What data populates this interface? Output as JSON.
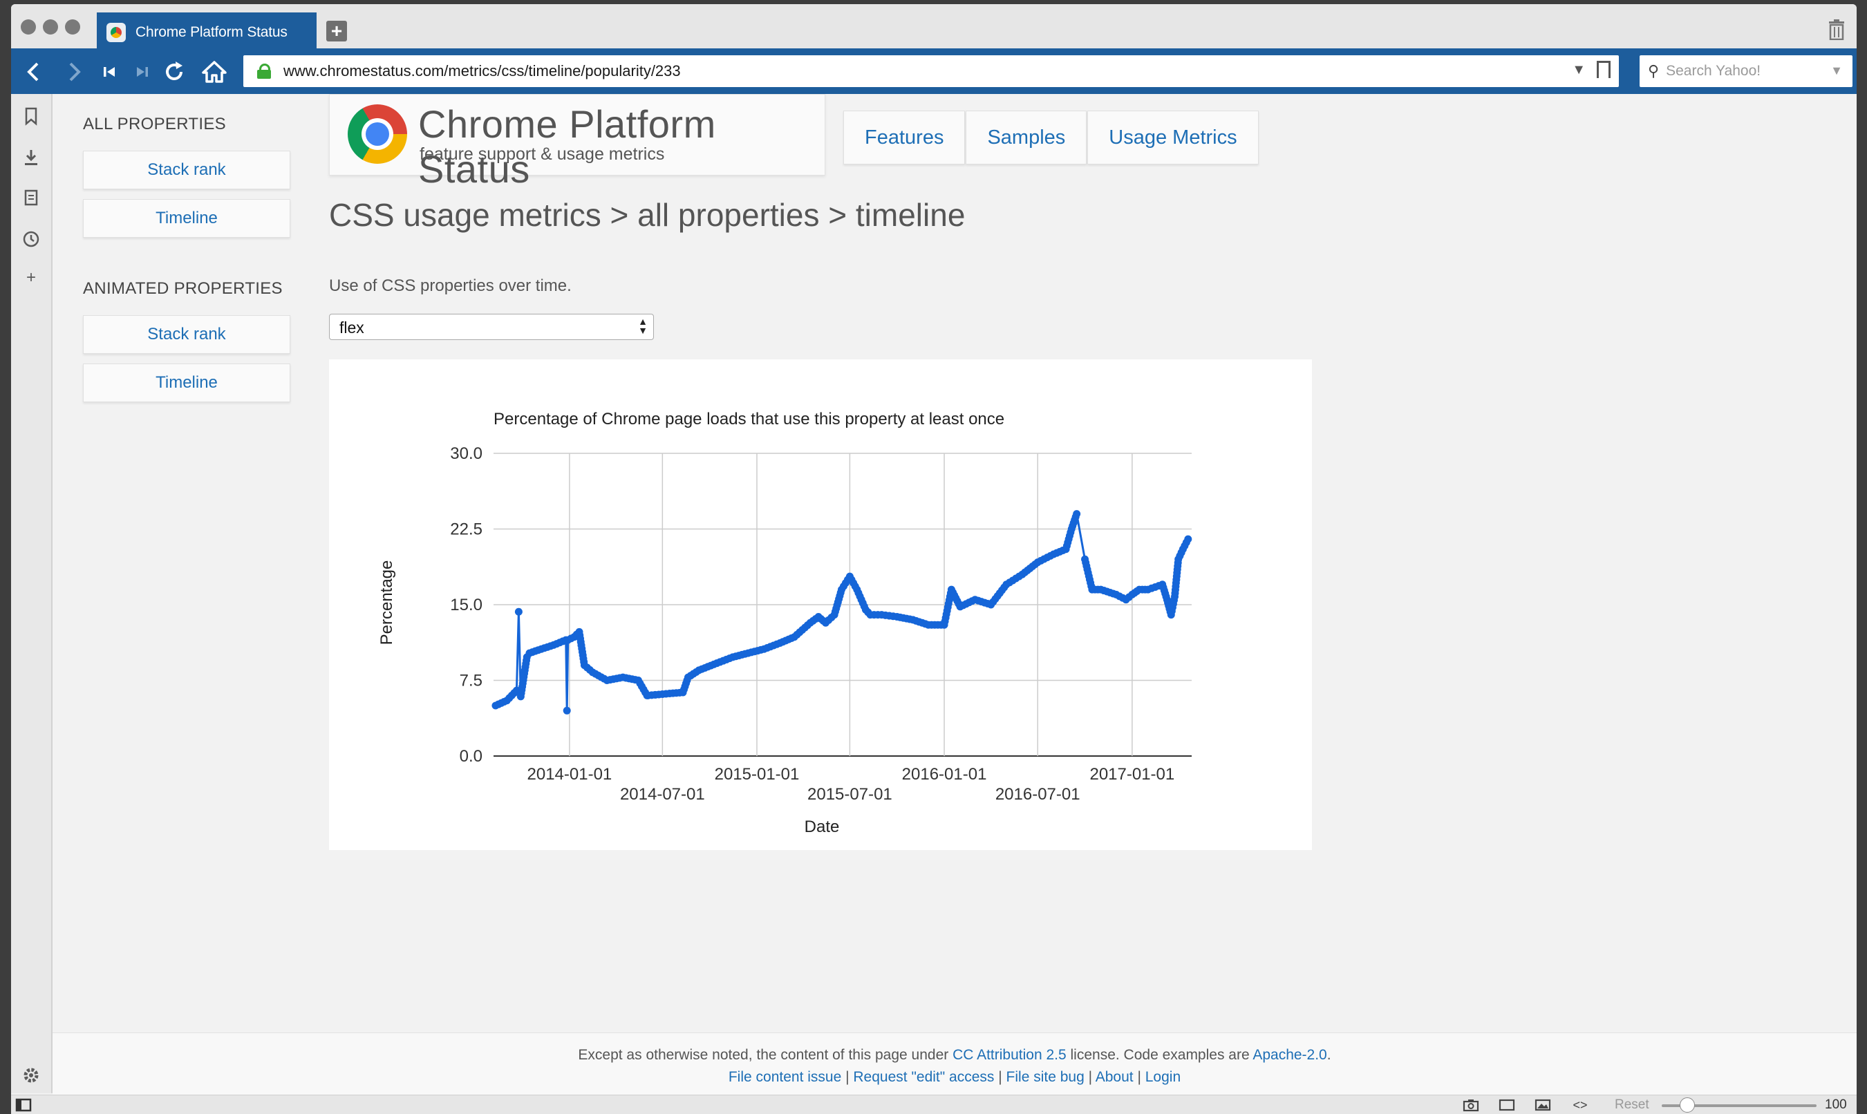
{
  "browser": {
    "tab_title": "Chrome Platform Status",
    "url": "www.chromestatus.com/metrics/css/timeline/popularity/233",
    "search_placeholder": "Search Yahoo!",
    "zoom": "100 %",
    "reset_label": "Reset"
  },
  "sidebar": {
    "all_heading": "ALL PROPERTIES",
    "all_items": [
      "Stack rank",
      "Timeline"
    ],
    "animated_heading": "ANIMATED PROPERTIES",
    "animated_items": [
      "Stack rank",
      "Timeline"
    ]
  },
  "brand": {
    "title": "Chrome Platform Status",
    "subtitle": "feature support & usage metrics"
  },
  "topnav": [
    "Features",
    "Samples",
    "Usage Metrics"
  ],
  "page": {
    "title": "CSS usage metrics > all properties > timeline",
    "intro": "Use of CSS properties over time.",
    "selected_property": "flex"
  },
  "chart_data": {
    "type": "line",
    "title": "Percentage of Chrome page loads that use this property at least once",
    "xlabel": "Date",
    "ylabel": "Percentage",
    "ylim": [
      0,
      30
    ],
    "yticks": [
      "0.0",
      "7.5",
      "15.0",
      "22.5",
      "30.0"
    ],
    "xticks_top": [
      "2014-01-01",
      "2015-01-01",
      "2016-01-01",
      "2017-01-01"
    ],
    "xticks_bottom": [
      "2014-07-01",
      "2015-07-01",
      "2016-07-01"
    ],
    "xlim": [
      "2013-08-06",
      "2017-04-27"
    ],
    "grid": true,
    "legend": "none",
    "color": "#1565d8",
    "series": [
      {
        "x": [
          "2013-08-10",
          "2013-09-01",
          "2013-09-20",
          "2013-09-24",
          "2013-09-28",
          "2013-10-10",
          "2013-10-15",
          "2013-11-01",
          "2013-12-01",
          "2013-12-25",
          "2013-12-27",
          "2013-12-29",
          "2014-01-10",
          "2014-01-20",
          "2014-01-30",
          "2014-02-15",
          "2014-03-15",
          "2014-04-15",
          "2014-05-15",
          "2014-06-01",
          "2014-06-03",
          "2014-07-15",
          "2014-08-10",
          "2014-08-20",
          "2014-09-10",
          "2014-10-15",
          "2014-11-15",
          "2014-12-15",
          "2015-01-15",
          "2015-02-15",
          "2015-03-15",
          "2015-04-15",
          "2015-05-01",
          "2015-05-15",
          "2015-06-01",
          "2015-06-15",
          "2015-07-01",
          "2015-07-15",
          "2015-08-01",
          "2015-08-10",
          "2015-09-01",
          "2015-10-01",
          "2015-11-01",
          "2015-12-01",
          "2016-01-01",
          "2016-01-15",
          "2016-02-01",
          "2016-03-01",
          "2016-04-01",
          "2016-05-01",
          "2016-06-01",
          "2016-07-01",
          "2016-08-01",
          "2016-08-25",
          "2016-09-05",
          "2016-09-15",
          "2016-10-01",
          "2016-10-15",
          "2016-11-01",
          "2016-12-01",
          "2016-12-20",
          "2017-01-01",
          "2017-01-15",
          "2017-02-01",
          "2017-03-01",
          "2017-03-10",
          "2017-03-18",
          "2017-03-25",
          "2017-04-01",
          "2017-04-10",
          "2017-04-20"
        ],
        "y": [
          5.0,
          5.5,
          6.5,
          14.3,
          5.9,
          9.8,
          10.2,
          10.5,
          11.0,
          11.5,
          4.5,
          11.5,
          11.8,
          12.3,
          9.0,
          8.3,
          7.5,
          7.8,
          7.5,
          6.0,
          6.0,
          6.2,
          6.3,
          7.8,
          8.5,
          9.2,
          9.8,
          10.2,
          10.6,
          11.2,
          11.8,
          13.2,
          13.8,
          13.2,
          14.0,
          16.5,
          17.8,
          16.5,
          14.5,
          14.0,
          14.0,
          13.8,
          13.5,
          13.0,
          13.0,
          16.5,
          14.8,
          15.5,
          15.0,
          17.0,
          18.0,
          19.2,
          20.0,
          20.5,
          22.5,
          24.0,
          19.5,
          16.5,
          16.5,
          16.0,
          15.5,
          16.0,
          16.5,
          16.5,
          17.0,
          15.5,
          14.0,
          15.8,
          19.5,
          20.5,
          21.5
        ]
      }
    ]
  },
  "footer": {
    "line1_prefix": "Except as otherwise noted, the content of this page under ",
    "cc_link": "CC Attribution 2.5",
    "line1_middle": " license. Code examples are ",
    "apache_link": "Apache-2.0",
    "line1_suffix": ".",
    "links": [
      "File content issue",
      "Request \"edit\" access",
      "File site bug",
      "About",
      "Login"
    ],
    "separator": " | "
  },
  "icons": {
    "back": "back-arrow-icon",
    "forward": "forward-arrow-icon",
    "first": "skip-first-icon",
    "last": "skip-last-icon",
    "reload": "reload-icon",
    "home": "home-icon",
    "lock": "lock-icon",
    "trash": "trash-icon",
    "settings": "gear-icon"
  }
}
